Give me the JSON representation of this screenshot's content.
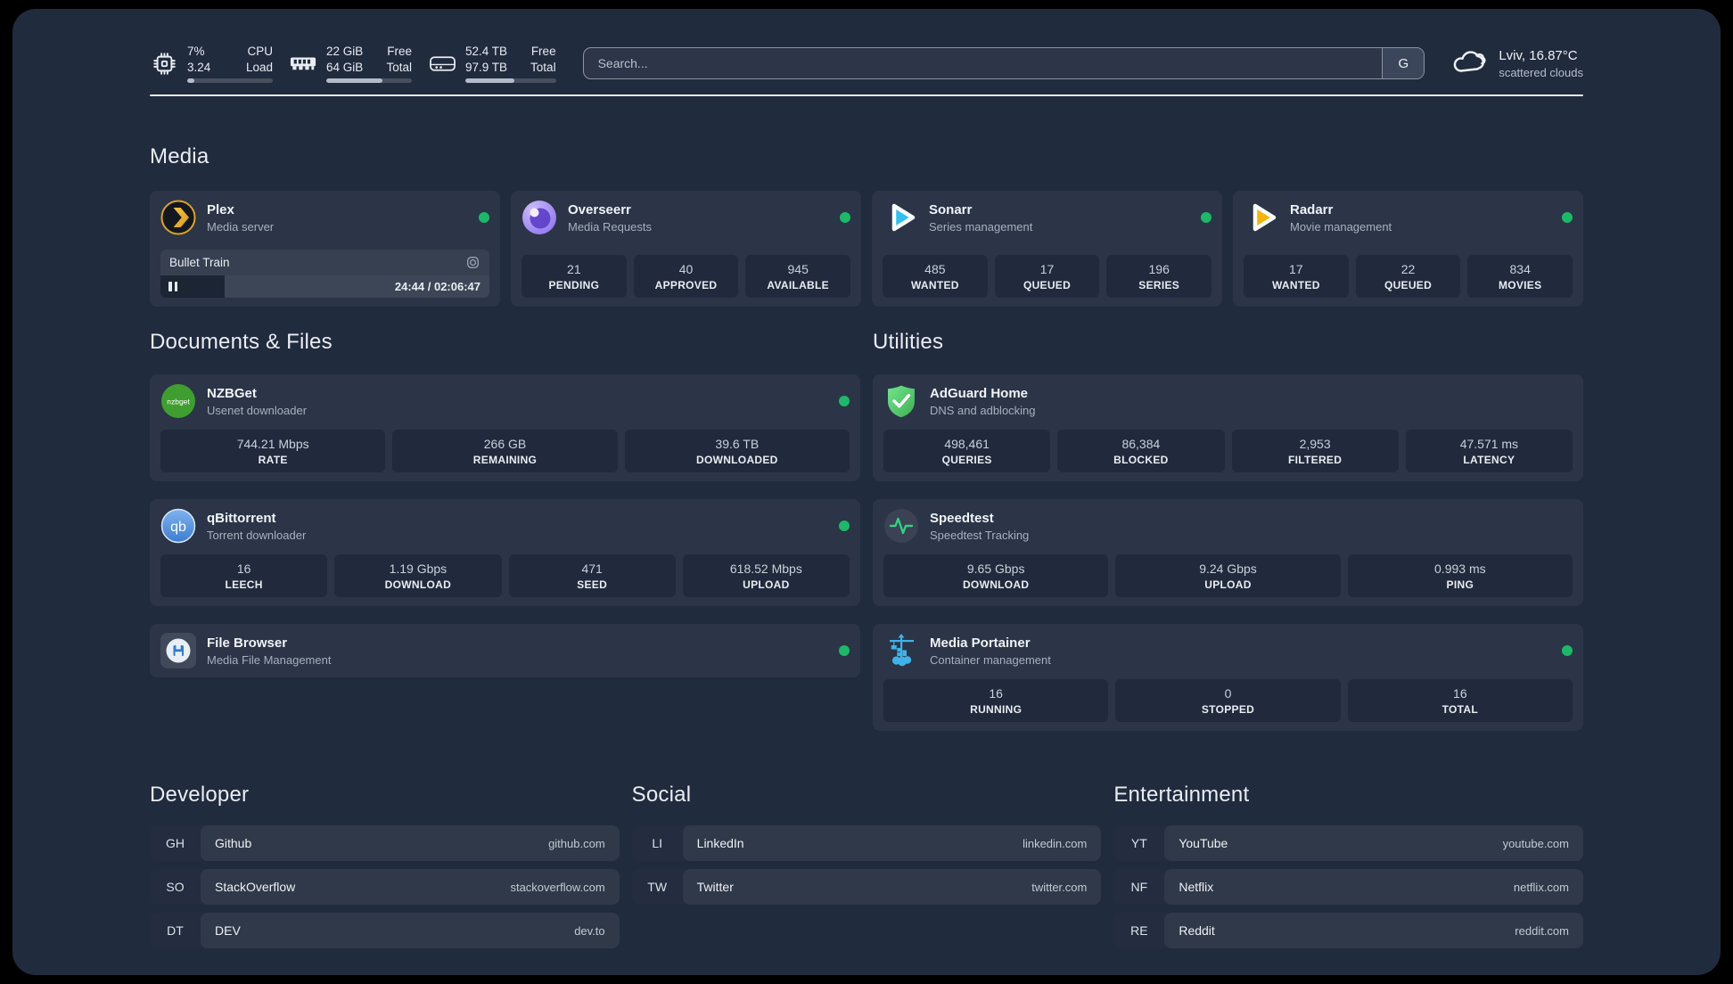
{
  "colors": {
    "status_online": "#1bb968",
    "accent_plex": "#e5a00d",
    "panel_bg": "#212b3e"
  },
  "header": {
    "cpu": {
      "value_top": "7%",
      "value_bottom": "3.24",
      "label_top": "CPU",
      "label_bottom": "Load",
      "bar_percent": 8
    },
    "memory": {
      "value_top": "22 GiB",
      "value_bottom": "64 GiB",
      "label_top": "Free",
      "label_bottom": "Total",
      "bar_percent": 66
    },
    "disk": {
      "value_top": "52.4 TB",
      "value_bottom": "97.9 TB",
      "label_top": "Free",
      "label_bottom": "Total",
      "bar_percent": 54
    },
    "search": {
      "placeholder": "Search...",
      "button_label": "G"
    },
    "weather": {
      "location": "Lviv, 16.87°C",
      "condition": "scattered clouds"
    }
  },
  "media": {
    "title": "Media",
    "plex": {
      "title": "Plex",
      "subtitle": "Media server",
      "now_playing": "Bullet Train",
      "time": "24:44 / 02:06:47",
      "progress_percent": 19.5
    },
    "overseerr": {
      "title": "Overseerr",
      "subtitle": "Media Requests",
      "stats": [
        {
          "value": "21",
          "label": "PENDING"
        },
        {
          "value": "40",
          "label": "APPROVED"
        },
        {
          "value": "945",
          "label": "AVAILABLE"
        }
      ]
    },
    "sonarr": {
      "title": "Sonarr",
      "subtitle": "Series management",
      "stats": [
        {
          "value": "485",
          "label": "WANTED"
        },
        {
          "value": "17",
          "label": "QUEUED"
        },
        {
          "value": "196",
          "label": "SERIES"
        }
      ]
    },
    "radarr": {
      "title": "Radarr",
      "subtitle": "Movie management",
      "stats": [
        {
          "value": "17",
          "label": "WANTED"
        },
        {
          "value": "22",
          "label": "QUEUED"
        },
        {
          "value": "834",
          "label": "MOVIES"
        }
      ]
    }
  },
  "documents": {
    "title": "Documents & Files",
    "nzbget": {
      "title": "NZBGet",
      "subtitle": "Usenet downloader",
      "stats": [
        {
          "value": "744.21 Mbps",
          "label": "RATE"
        },
        {
          "value": "266 GB",
          "label": "REMAINING"
        },
        {
          "value": "39.6 TB",
          "label": "DOWNLOADED"
        }
      ]
    },
    "qbittorrent": {
      "title": "qBittorrent",
      "subtitle": "Torrent downloader",
      "stats": [
        {
          "value": "16",
          "label": "LEECH"
        },
        {
          "value": "1.19 Gbps",
          "label": "DOWNLOAD"
        },
        {
          "value": "471",
          "label": "SEED"
        },
        {
          "value": "618.52 Mbps",
          "label": "UPLOAD"
        }
      ]
    },
    "filebrowser": {
      "title": "File Browser",
      "subtitle": "Media File Management"
    }
  },
  "utilities": {
    "title": "Utilities",
    "adguard": {
      "title": "AdGuard Home",
      "subtitle": "DNS and adblocking",
      "stats": [
        {
          "value": "498,461",
          "label": "QUERIES"
        },
        {
          "value": "86,384",
          "label": "BLOCKED"
        },
        {
          "value": "2,953",
          "label": "FILTERED"
        },
        {
          "value": "47.571 ms",
          "label": "LATENCY"
        }
      ]
    },
    "speedtest": {
      "title": "Speedtest",
      "subtitle": "Speedtest Tracking",
      "stats": [
        {
          "value": "9.65 Gbps",
          "label": "DOWNLOAD"
        },
        {
          "value": "9.24 Gbps",
          "label": "UPLOAD"
        },
        {
          "value": "0.993 ms",
          "label": "PING"
        }
      ]
    },
    "portainer": {
      "title": "Media Portainer",
      "subtitle": "Container management",
      "stats": [
        {
          "value": "16",
          "label": "RUNNING"
        },
        {
          "value": "0",
          "label": "STOPPED"
        },
        {
          "value": "16",
          "label": "TOTAL"
        }
      ]
    }
  },
  "bookmarks": {
    "developer": {
      "title": "Developer",
      "items": [
        {
          "abbr": "GH",
          "name": "Github",
          "url": "github.com"
        },
        {
          "abbr": "SO",
          "name": "StackOverflow",
          "url": "stackoverflow.com"
        },
        {
          "abbr": "DT",
          "name": "DEV",
          "url": "dev.to"
        }
      ]
    },
    "social": {
      "title": "Social",
      "items": [
        {
          "abbr": "LI",
          "name": "LinkedIn",
          "url": "linkedin.com"
        },
        {
          "abbr": "TW",
          "name": "Twitter",
          "url": "twitter.com"
        }
      ]
    },
    "entertainment": {
      "title": "Entertainment",
      "items": [
        {
          "abbr": "YT",
          "name": "YouTube",
          "url": "youtube.com"
        },
        {
          "abbr": "NF",
          "name": "Netflix",
          "url": "netflix.com"
        },
        {
          "abbr": "RE",
          "name": "Reddit",
          "url": "reddit.com"
        }
      ]
    }
  }
}
